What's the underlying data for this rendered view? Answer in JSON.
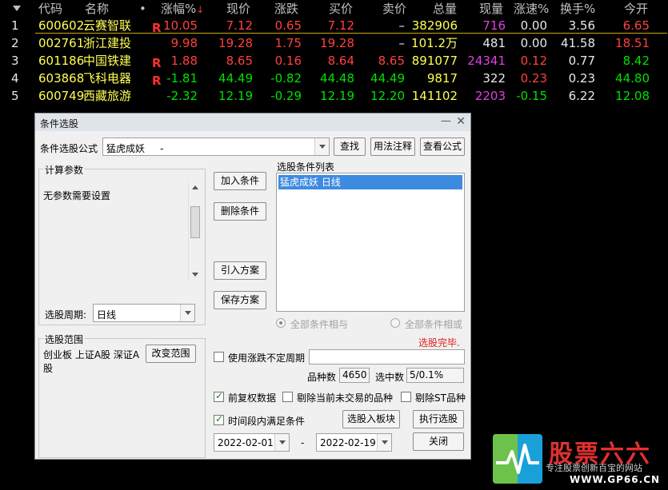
{
  "grid": {
    "headers": {
      "code": "代码",
      "name": "名称",
      "dot": "•",
      "chg_pct": "涨幅%",
      "price": "现价",
      "change": "涨跌",
      "bid": "买价",
      "ask": "卖价",
      "volume": "总量",
      "last_vol": "现量",
      "speed": "涨速%",
      "turnover": "换手%",
      "open": "今开"
    },
    "rows": [
      {
        "idx": "1",
        "code": "600602",
        "name": "云赛智联",
        "mark": "R",
        "chg_pct": "10.05",
        "price": "7.12",
        "change": "0.65",
        "bid": "7.12",
        "ask": "–",
        "volume": "382906",
        "last_vol": "716",
        "speed": "0.00",
        "turnover": "3.56",
        "open": "6.65"
      },
      {
        "idx": "2",
        "code": "002761",
        "name": "浙江建投",
        "mark": "",
        "chg_pct": "9.98",
        "price": "19.28",
        "change": "1.75",
        "bid": "19.28",
        "ask": "–",
        "volume": "101.2万",
        "last_vol": "481",
        "speed": "0.00",
        "turnover": "41.58",
        "open": "18.51"
      },
      {
        "idx": "3",
        "code": "601186",
        "name": "中国铁建",
        "mark": "R",
        "chg_pct": "1.88",
        "price": "8.65",
        "change": "0.16",
        "bid": "8.64",
        "ask": "8.65",
        "volume": "891077",
        "last_vol": "24341",
        "speed": "0.12",
        "turnover": "0.77",
        "open": "8.42"
      },
      {
        "idx": "4",
        "code": "603868",
        "name": "飞科电器",
        "mark": "R",
        "chg_pct": "-1.81",
        "price": "44.49",
        "change": "-0.82",
        "bid": "44.48",
        "ask": "44.49",
        "volume": "9817",
        "last_vol": "322",
        "speed": "0.23",
        "turnover": "0.23",
        "open": "44.80"
      },
      {
        "idx": "5",
        "code": "600749",
        "name": "西藏旅游",
        "mark": "",
        "chg_pct": "-2.32",
        "price": "12.19",
        "change": "-0.29",
        "bid": "12.19",
        "ask": "12.20",
        "volume": "141102",
        "last_vol": "2203",
        "speed": "-0.15",
        "turnover": "6.22",
        "open": "12.08"
      }
    ]
  },
  "dialog": {
    "title": "条件选股",
    "min_icon": "—",
    "close_icon": "✕",
    "formula_label": "条件选股公式",
    "formula_value": "猛虎成妖     -",
    "find_btn": "查找",
    "usage_btn": "用法注释",
    "view_btn": "查看公式",
    "params_group": "计算参数",
    "params_text": "无参数需要设置",
    "period_label": "选股周期:",
    "period_value": "日线",
    "add_btn": "加入条件",
    "delete_btn": "删除条件",
    "import_btn": "引入方案",
    "save_btn": "保存方案",
    "list_label": "选股条件列表",
    "list_items": [
      "猛虎成妖  日线"
    ],
    "radio_and": "全部条件相与",
    "radio_or": "全部条件相或",
    "status": "选股完毕.",
    "range_group": "选股范围",
    "range_text": "创业板 上证A股 深证A股",
    "change_range_btn": "改变范围",
    "use_period_label": "使用涨跌不定周期",
    "count_label": "品种数",
    "count_value": "4650",
    "selected_label": "选中数",
    "selected_value": "5/0.1%",
    "prev_adjust_label": "前复权数据",
    "excl_notrade_label": "剔除当前未交易的品种",
    "excl_st_label": "剔除ST品种",
    "time_cond_label": "时间段内满足条件",
    "to_block_btn": "选股入板块",
    "run_btn": "执行选股",
    "close_btn": "关闭",
    "date_from": "2022-02-01",
    "date_sep": "-",
    "date_to": "2022-02-19"
  },
  "watermark": {
    "brand": "股票六六",
    "slogan": "专注股票创新百宝的网站",
    "url": "WWW.GP66.CN"
  }
}
